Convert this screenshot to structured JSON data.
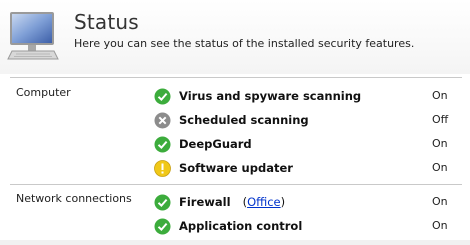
{
  "header": {
    "title": "Status",
    "subtitle": "Here you can see the status of the installed security features."
  },
  "colors": {
    "ok": "#3cac3c",
    "disabled": "#8c8c8c",
    "warning": "#f0c818",
    "link": "#0033cc"
  },
  "sections": [
    {
      "label": "Computer",
      "items": [
        {
          "name": "Virus and spyware scanning",
          "status_icon": "check-icon",
          "state": "On"
        },
        {
          "name": "Scheduled scanning",
          "status_icon": "x-icon",
          "state": "Off"
        },
        {
          "name": "DeepGuard",
          "status_icon": "check-icon",
          "state": "On"
        },
        {
          "name": "Software updater",
          "status_icon": "warning-icon",
          "state": "On"
        }
      ]
    },
    {
      "label": "Network connections",
      "items": [
        {
          "name": "Firewall",
          "status_icon": "check-icon",
          "state": "On",
          "profile_link": "Office"
        },
        {
          "name": "Application control",
          "status_icon": "check-icon",
          "state": "On"
        }
      ]
    }
  ]
}
